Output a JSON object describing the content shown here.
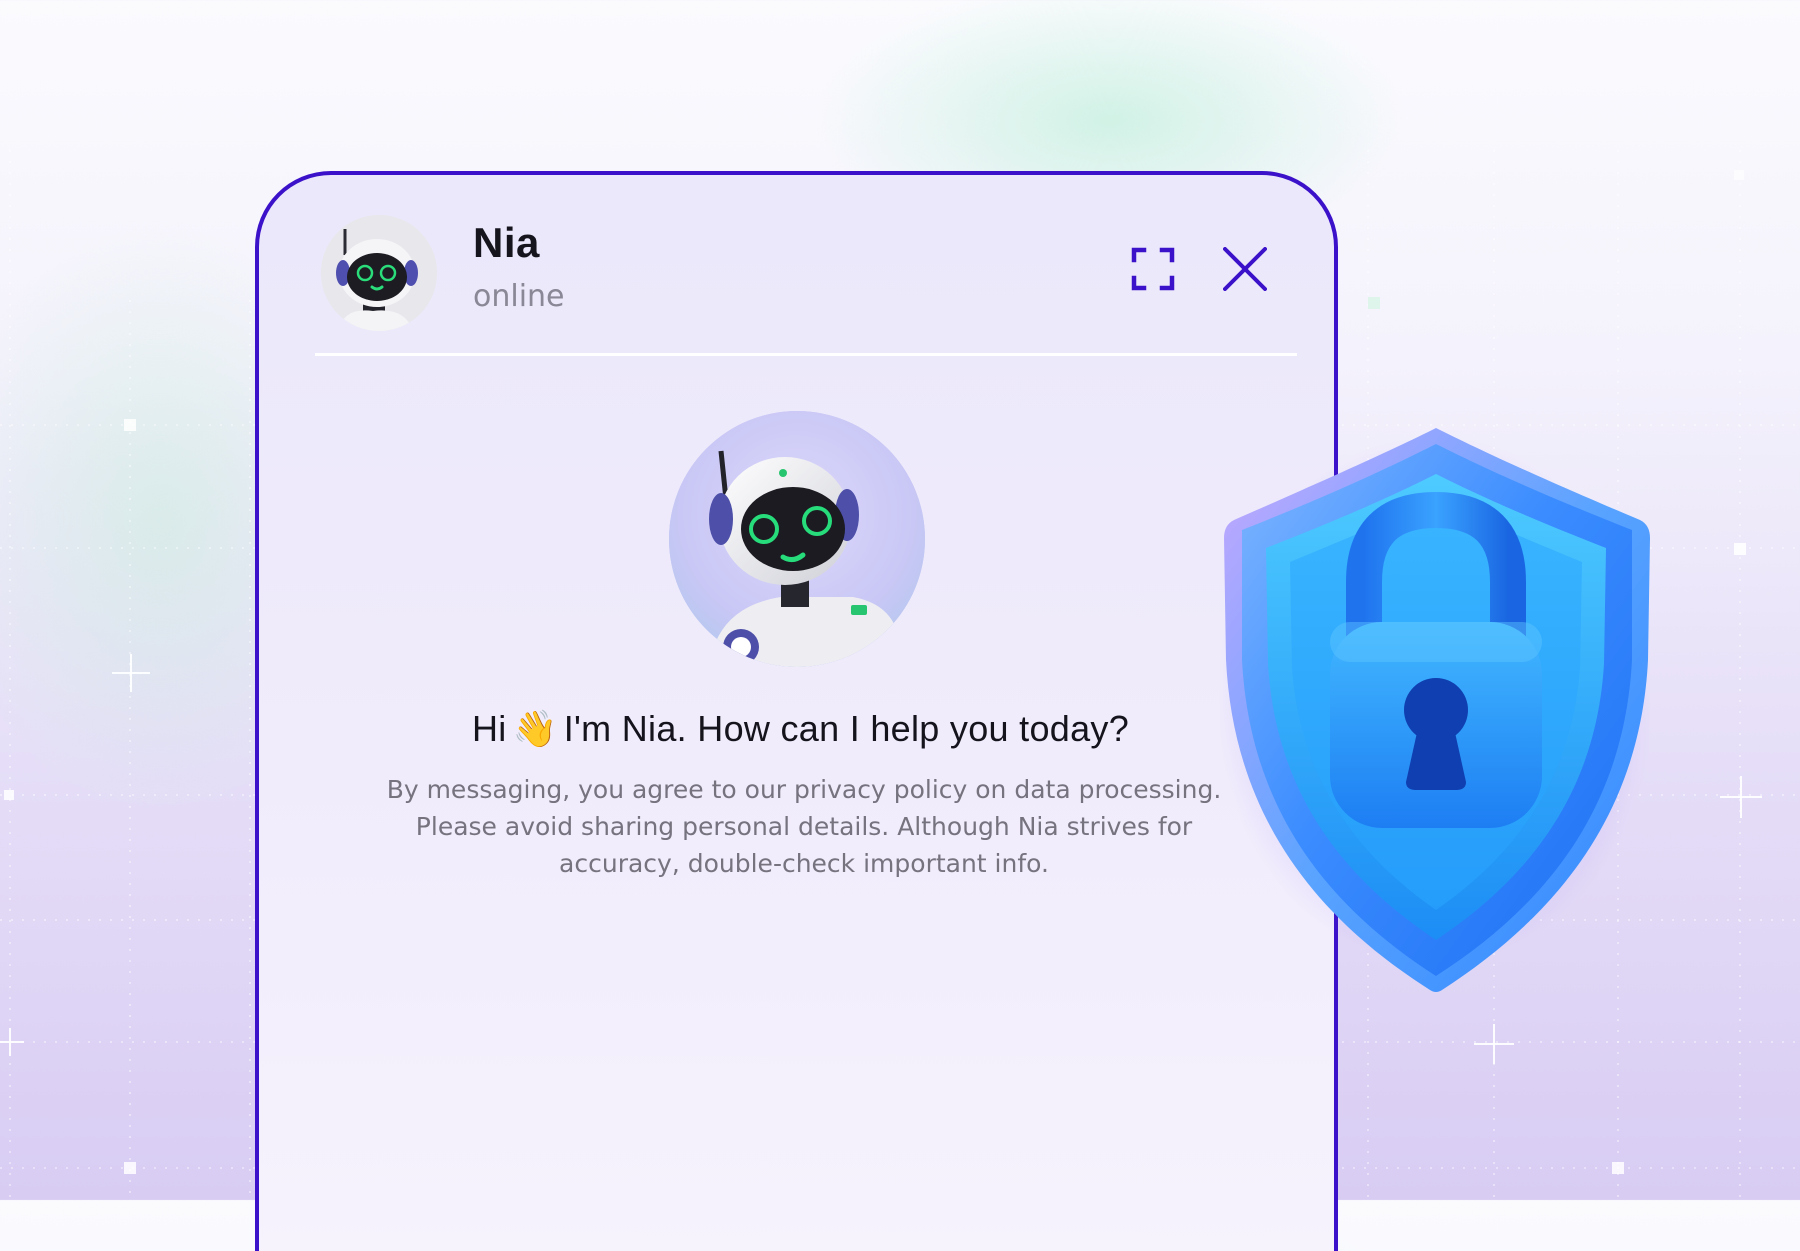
{
  "header": {
    "name": "Nia",
    "status": "online"
  },
  "welcome": {
    "greeting_prefix": "Hi",
    "greeting_emoji": "👋",
    "greeting_suffix": "I'm Nia. How can I help you today?",
    "disclaimer": "By messaging, you agree to our privacy policy on data processing. Please avoid sharing personal details. Although Nia strives for accuracy, double-check important info."
  },
  "icons": {
    "expand": "expand-icon",
    "close": "close-icon",
    "shield": "shield-lock-icon",
    "avatar": "robot-avatar"
  },
  "colors": {
    "accent": "#3b12c9",
    "text_primary": "#16141d",
    "text_secondary": "#8a8796",
    "shield_light": "#3fb4ff",
    "shield_dark": "#1f6bf0"
  }
}
